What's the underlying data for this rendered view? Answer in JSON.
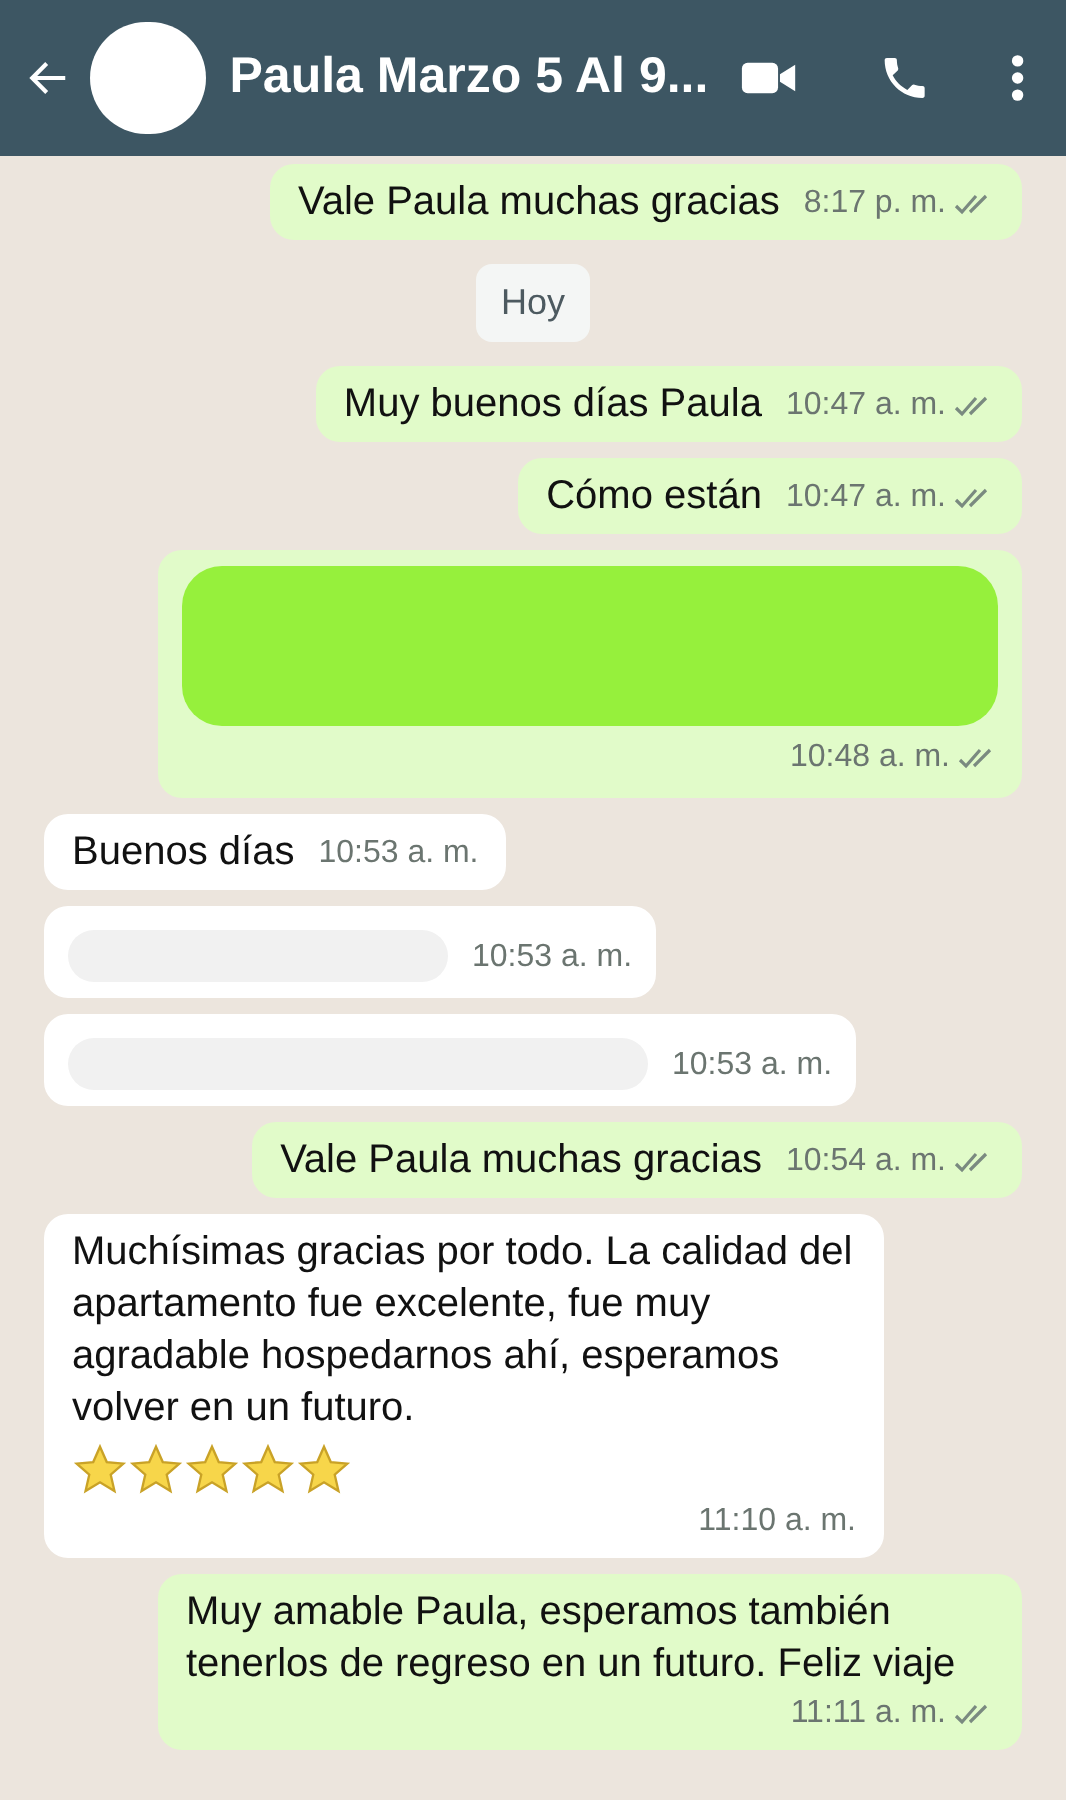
{
  "header": {
    "title": "Paula Marzo 5 Al 9..."
  },
  "messages": [
    {
      "kind": "out",
      "text": "Vale Paula muchas gracias",
      "time": "8:17 p. m.",
      "delivered": true
    },
    {
      "kind": "date",
      "text": "Hoy"
    },
    {
      "kind": "out",
      "text": "Muy buenos días Paula",
      "time": "10:47 a. m.",
      "delivered": true
    },
    {
      "kind": "out",
      "text": "Cómo están",
      "time": "10:47 a. m.",
      "delivered": true
    },
    {
      "kind": "out",
      "redacted": true,
      "time": "10:48 a. m.",
      "delivered": true
    },
    {
      "kind": "in",
      "text": "Buenos días",
      "time": "10:53 a. m."
    },
    {
      "kind": "in",
      "redacted": true,
      "time": "10:53 a. m."
    },
    {
      "kind": "in",
      "redacted": true,
      "time": "10:53 a. m."
    },
    {
      "kind": "out",
      "text": "Vale Paula muchas gracias",
      "time": "10:54 a. m.",
      "delivered": true
    },
    {
      "kind": "in",
      "text": "Muchísimas gracias por todo. La calidad del apartamento fue excelente, fue muy agradable hospedarnos ahí,  esperamos volver en un futuro.",
      "stars": 5,
      "time": "11:10 a. m."
    },
    {
      "kind": "out",
      "text": "Muy amable Paula, esperamos también tenerlos de regreso en un futuro. Feliz viaje",
      "time": "11:11 a. m.",
      "delivered": true
    }
  ]
}
